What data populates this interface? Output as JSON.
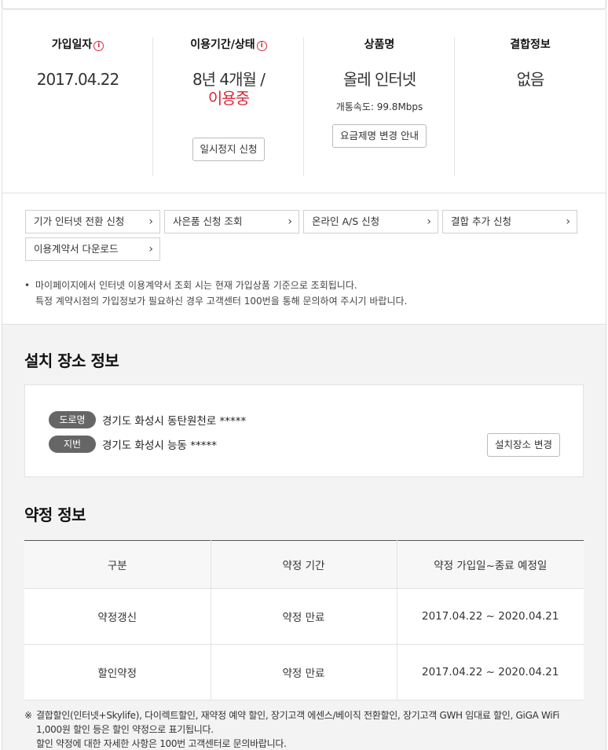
{
  "summary": {
    "join_date": {
      "title": "가입일자",
      "info_icon": "info-icon",
      "value": "2017.04.22"
    },
    "period": {
      "title": "이용기간/상태",
      "info_icon": "info-icon",
      "value": "8년 4개월 /",
      "status": "이용중",
      "button": "일시정지 신청"
    },
    "product": {
      "title": "상품명",
      "value": "올레 인터넷",
      "speed": "개통속도: 99.8Mbps",
      "button": "요금제명 변경 안내"
    },
    "bundle": {
      "title": "결합정보",
      "value": "없음"
    }
  },
  "quick_links": [
    {
      "label": "기가 인터넷 전환 신청",
      "icon": "chevron-right-icon"
    },
    {
      "label": "사은품 신청 조회",
      "icon": "chevron-right-icon"
    },
    {
      "label": "온라인 A/S 신청",
      "icon": "chevron-right-icon"
    },
    {
      "label": "결합 추가 신청",
      "icon": "chevron-right-icon"
    },
    {
      "label": "이용계약서 다운로드",
      "icon": "chevron-right-icon"
    }
  ],
  "notes": {
    "bullet": "•",
    "line1": "마이페이지에서 인터넷 이용계약서 조회 시는 현재 가입상품 기준으로 조회됩니다.",
    "line2": "특정 계약시점의 가입정보가 필요하신 경우 고객센터 100번을 통해 문의하여 주시기 바랍니다."
  },
  "install": {
    "title": "설치 장소 정보",
    "road_label": "도로명",
    "road_address": "경기도 화성시 동탄원천로 *****",
    "lot_label": "지번",
    "lot_address": "경기도 화성시 능동 *****",
    "change_button": "설치장소 변경"
  },
  "contract": {
    "title": "약정 정보",
    "headers": [
      "구분",
      "약정 기간",
      "약정 가입일~종료 예정일"
    ],
    "rows": [
      [
        "약정갱신",
        "약정 만료",
        "2017.04.22 ~ 2020.04.21"
      ],
      [
        "할인약정",
        "약정 만료",
        "2017.04.22 ~ 2020.04.21"
      ]
    ]
  },
  "footnote": {
    "mark": "※",
    "line1": "결합할인(인터넷+Skylife), 다이렉트할인, 재약정 예약 할인, 장기고객 에센스/베이직 전환할인, 장기고객 GWH 임대료 할인, GiGA WiFi",
    "line2": "1,000원 할인 등은 할인 약정으로 표기됩니다.",
    "line3": "할인 약정에 대한 자세한 사항은 100번 고객센터로 문의바랍니다."
  },
  "colors": {
    "accent": "#d8283a",
    "pill": "#666666",
    "section_bg": "#f3f3f3"
  }
}
